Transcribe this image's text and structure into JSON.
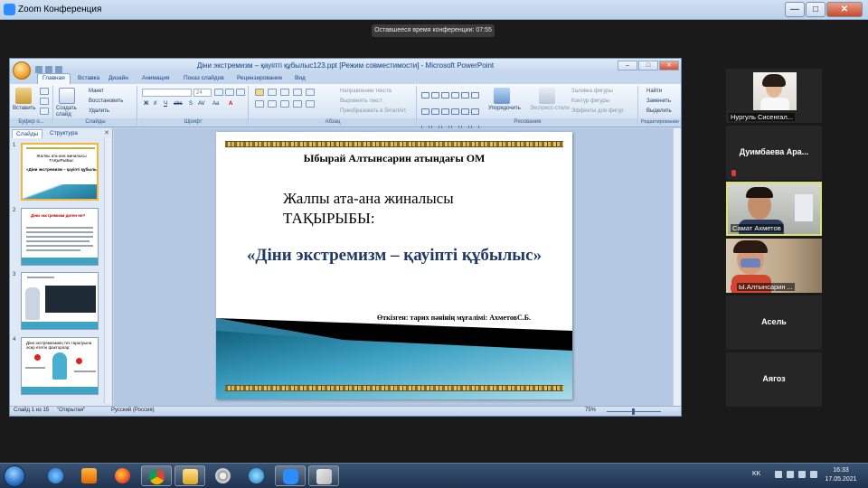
{
  "zoom": {
    "title": "Zoom Конференция",
    "minimize": "—",
    "maximize": "□",
    "close": "✕",
    "timer": "Оставшееся время конференции: 07:55"
  },
  "ppt": {
    "title": "Діни экстремизм – қауіпті құбылыс123.ppt [Режим совместимости] - Microsoft PowerPoint",
    "tabs": [
      "Главная",
      "Вставка",
      "Дизайн",
      "Анимация",
      "Показ слайдов",
      "Рецензирование",
      "Вид"
    ],
    "ribbon": {
      "paste": "Вставить",
      "layout": "Макет",
      "reset": "Восстановить",
      "create_slide": "Создать слайд",
      "delete": "Удалить",
      "font_size": "24",
      "text_direction": "Направление текста",
      "align_text": "Выровнять текст",
      "smartart": "Преобразовать в SmartArt",
      "arrange": "Упорядочить",
      "express_styles": "Экспресс-стили",
      "shape_fill": "Заливка фигуры",
      "shape_outline": "Контур фигуры",
      "shape_effects": "Эффекты для фигур",
      "find": "Найти",
      "replace": "Заменить",
      "select": "Выделить",
      "groups": {
        "clipboard": "Буфер о...",
        "slides": "Слайды",
        "font": "Шрифт",
        "paragraph": "Абзац",
        "drawing": "Рисование",
        "editing": "Редактирование"
      }
    },
    "panel": {
      "tab_slides": "Слайды",
      "tab_outline": "Структура",
      "close": "✕",
      "thumb_numbers": [
        "1",
        "2",
        "3",
        "4"
      ],
      "thumb1_title": "Жалпы ата-ана жиналысы ТАҚЫРЫБЫ:",
      "thumb1_sub": "«Діни экстремизм – қауіпті құбылыс»",
      "thumb2_title": "Діни экстремизм деген не?",
      "thumb4_title": "Діни экстремизмнің тез таралуына әсер ететін факторлар:"
    },
    "slide": {
      "school": "Ыбырай Алтынсарин атындағы ОМ",
      "heading_line1": "Жалпы ата-ана жиналысы",
      "heading_line2": "ТАҚЫРЫБЫ:",
      "topic": "«Діни экстремизм – қауіпті құбылыс»",
      "presenter": "Өткізген: тарих пәнінің мұғалімі: АхметовС.Б."
    },
    "status": {
      "slide_of": "Слайд 1 из 15",
      "theme": "\"Открытая\"",
      "language": "Русский (Россия)",
      "zoom": "75%"
    }
  },
  "participants": [
    {
      "name": "Нургуль Сисенгал...",
      "video": true,
      "muted": false
    },
    {
      "name": "Дуимбаева  Ара...",
      "video": false,
      "muted": true
    },
    {
      "name": "Самат Ахметов",
      "video": true,
      "muted": false,
      "speaking": true
    },
    {
      "name": "Ы.Алтынсарин ...",
      "video": true,
      "muted": true
    },
    {
      "name": "Асель",
      "video": false,
      "muted": false
    },
    {
      "name": "Аягоз",
      "video": false,
      "muted": false
    }
  ],
  "taskbar": {
    "language": "KK",
    "time": "16:33",
    "date": "17.05.2021",
    "apps": [
      "internet-explorer-icon",
      "media-player-icon",
      "firefox-icon",
      "chrome-icon",
      "file-explorer-icon",
      "film-reel-icon",
      "mail-icon",
      "zoom-icon",
      "paint-icon"
    ]
  },
  "colors": {
    "zoom_dark": "#1a1a1a",
    "ribbon_blue": "#c5d7ed",
    "speaker_highlight": "#d9e36c",
    "mute_red": "#e23a3a",
    "slide_teal": "#3fa3c4"
  }
}
